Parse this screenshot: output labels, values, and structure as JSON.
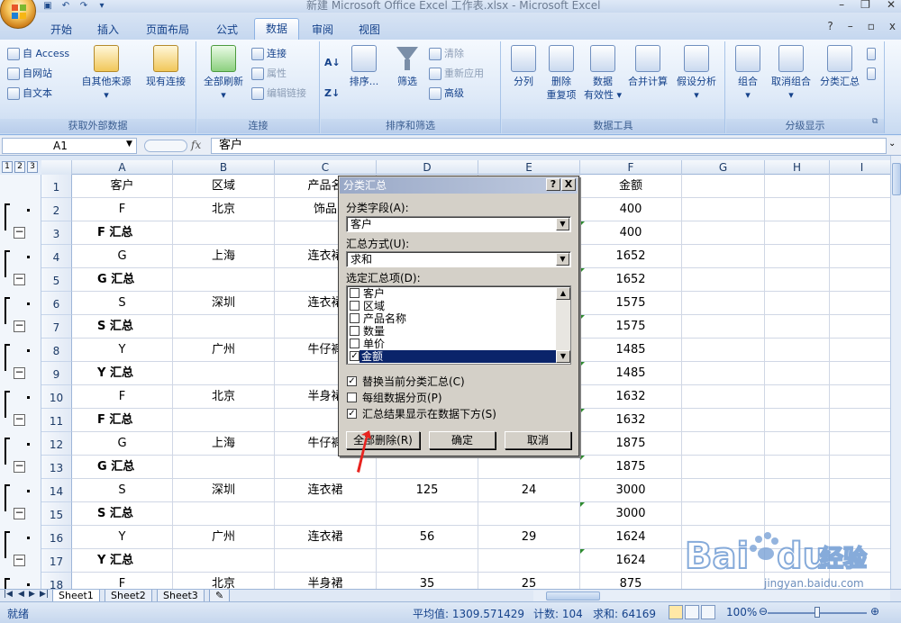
{
  "window": {
    "title": "新建 Microsoft Office Excel 工作表.xlsx - Microsoft Excel",
    "controls": [
      "–",
      "❐",
      "✕"
    ]
  },
  "tabs": [
    {
      "label": "开始",
      "active": false
    },
    {
      "label": "插入",
      "active": false
    },
    {
      "label": "页面布局",
      "active": false
    },
    {
      "label": "公式",
      "active": false
    },
    {
      "label": "数据",
      "active": true
    },
    {
      "label": "审阅",
      "active": false
    },
    {
      "label": "视图",
      "active": false
    }
  ],
  "tab_right": {
    "help": "?",
    "min": "–",
    "restore": "▫",
    "close": "x"
  },
  "ribbon": {
    "get_external": {
      "label": "获取外部数据",
      "from_access": "自 Access",
      "from_web": "自网站",
      "from_text": "自文本",
      "from_other": "自其他来源",
      "existing_conn": "现有连接"
    },
    "connections": {
      "label": "连接",
      "refresh_all": "全部刷新",
      "conn": "连接",
      "props": "属性",
      "edit_links": "编辑链接"
    },
    "sort_filter": {
      "label": "排序和筛选",
      "sort": "排序...",
      "filter": "筛选",
      "clear": "清除",
      "reapply": "重新应用",
      "advanced": "高级"
    },
    "data_tools": {
      "label": "数据工具",
      "split": "分列",
      "remove_dup_1": "删除",
      "remove_dup_2": "重复项",
      "validation_1": "数据",
      "validation_2": "有效性",
      "consolidate": "合并计算",
      "whatif": "假设分析"
    },
    "outline": {
      "label": "分级显示",
      "group": "组合",
      "ungroup": "取消组合",
      "subtotal": "分类汇总"
    }
  },
  "formula_bar": {
    "name_box": "A1",
    "fx": "fx",
    "value": "客户"
  },
  "outline_levels": [
    "1",
    "2",
    "3"
  ],
  "columns": [
    "A",
    "B",
    "C",
    "D",
    "E",
    "F",
    "G",
    "H",
    "I"
  ],
  "rows": [
    {
      "num": "1",
      "A": "客户",
      "B": "区域",
      "C": "产品名",
      "D": "",
      "E": "",
      "F": "金额",
      "total": false
    },
    {
      "num": "2",
      "A": "F",
      "B": "北京",
      "C": "饰品",
      "D": "",
      "E": "",
      "F": "400",
      "total": false
    },
    {
      "num": "3",
      "A": "F 汇总",
      "B": "",
      "C": "",
      "D": "",
      "E": "",
      "F": "400",
      "total": true
    },
    {
      "num": "4",
      "A": "G",
      "B": "上海",
      "C": "连衣裙",
      "D": "",
      "E": "",
      "F": "1652",
      "total": false
    },
    {
      "num": "5",
      "A": "G 汇总",
      "B": "",
      "C": "",
      "D": "",
      "E": "",
      "F": "1652",
      "total": true
    },
    {
      "num": "6",
      "A": "S",
      "B": "深圳",
      "C": "连衣裙",
      "D": "",
      "E": "",
      "F": "1575",
      "total": false
    },
    {
      "num": "7",
      "A": "S 汇总",
      "B": "",
      "C": "",
      "D": "",
      "E": "",
      "F": "1575",
      "total": true
    },
    {
      "num": "8",
      "A": "Y",
      "B": "广州",
      "C": "牛仔裤",
      "D": "",
      "E": "",
      "F": "1485",
      "total": false
    },
    {
      "num": "9",
      "A": "Y 汇总",
      "B": "",
      "C": "",
      "D": "",
      "E": "",
      "F": "1485",
      "total": true
    },
    {
      "num": "10",
      "A": "F",
      "B": "北京",
      "C": "半身裙",
      "D": "",
      "E": "",
      "F": "1632",
      "total": false
    },
    {
      "num": "11",
      "A": "F 汇总",
      "B": "",
      "C": "",
      "D": "",
      "E": "",
      "F": "1632",
      "total": true
    },
    {
      "num": "12",
      "A": "G",
      "B": "上海",
      "C": "牛仔裤",
      "D": "",
      "E": "",
      "F": "1875",
      "total": false
    },
    {
      "num": "13",
      "A": "G 汇总",
      "B": "",
      "C": "",
      "D": "",
      "E": "",
      "F": "1875",
      "total": true
    },
    {
      "num": "14",
      "A": "S",
      "B": "深圳",
      "C": "连衣裙",
      "D": "125",
      "E": "24",
      "F": "3000",
      "total": false
    },
    {
      "num": "15",
      "A": "S 汇总",
      "B": "",
      "C": "",
      "D": "",
      "E": "",
      "F": "3000",
      "total": true
    },
    {
      "num": "16",
      "A": "Y",
      "B": "广州",
      "C": "连衣裙",
      "D": "56",
      "E": "29",
      "F": "1624",
      "total": false
    },
    {
      "num": "17",
      "A": "Y 汇总",
      "B": "",
      "C": "",
      "D": "",
      "E": "",
      "F": "1624",
      "total": true
    },
    {
      "num": "18",
      "A": "F",
      "B": "北京",
      "C": "半身裙",
      "D": "35",
      "E": "25",
      "F": "875",
      "total": false
    }
  ],
  "sheets": [
    "Sheet1",
    "Sheet2",
    "Sheet3"
  ],
  "status": {
    "ready": "就绪",
    "average": "平均值: 1309.571429",
    "count": "计数: 104",
    "sum": "求和: 64169",
    "zoom": "100%"
  },
  "dialog": {
    "title": "分类汇总",
    "help": "?",
    "close": "X",
    "group_by_label": "分类字段(A):",
    "group_by_value": "客户",
    "function_label": "汇总方式(U):",
    "function_value": "求和",
    "add_to_label": "选定汇总项(D):",
    "fields": [
      {
        "label": "客户",
        "checked": false,
        "selected": false
      },
      {
        "label": "区域",
        "checked": false,
        "selected": false
      },
      {
        "label": "产品名称",
        "checked": false,
        "selected": false
      },
      {
        "label": "数量",
        "checked": false,
        "selected": false
      },
      {
        "label": "单价",
        "checked": false,
        "selected": false
      },
      {
        "label": "金额",
        "checked": true,
        "selected": true
      }
    ],
    "options": [
      {
        "label": "替换当前分类汇总(C)",
        "checked": true
      },
      {
        "label": "每组数据分页(P)",
        "checked": false
      },
      {
        "label": "汇总结果显示在数据下方(S)",
        "checked": true
      }
    ],
    "remove_all": "全部删除(R)",
    "ok": "确定",
    "cancel": "取消"
  },
  "watermark": {
    "brand": "Bai",
    "brand2": "du",
    "brand_cn": "经验",
    "url": "jingyan.baidu.com"
  },
  "colors": {
    "accent": "#15428b",
    "selection": "#0a246a",
    "mark": "#e8231f"
  }
}
